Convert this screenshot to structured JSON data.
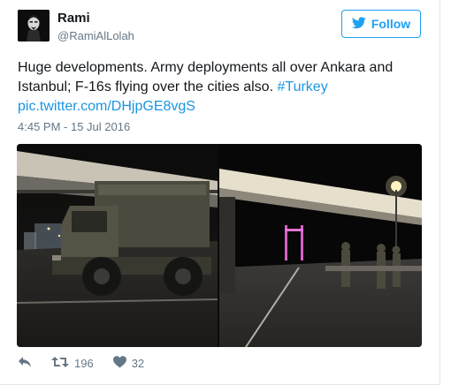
{
  "user": {
    "name": "Rami",
    "handle": "@RamiAlLolah"
  },
  "follow_label": "Follow",
  "tweet": {
    "text": "Huge developments. Army deployments all over Ankara and Istanbul; F-16s flying over the cities also.",
    "hashtag": "#Turkey",
    "link": "pic.twitter.com/DHjpGE8vgS",
    "timestamp": "4:45 PM - 15 Jul 2016"
  },
  "stats": {
    "retweets": "196",
    "likes": "32"
  },
  "icons": {
    "reply": "reply-icon",
    "retweet": "retweet-icon",
    "like": "heart-icon",
    "follow": "twitter-bird-icon"
  },
  "colors": {
    "accent": "#1da1f2",
    "link": "#1b95e0",
    "muted": "#657786",
    "text": "#14171a"
  }
}
